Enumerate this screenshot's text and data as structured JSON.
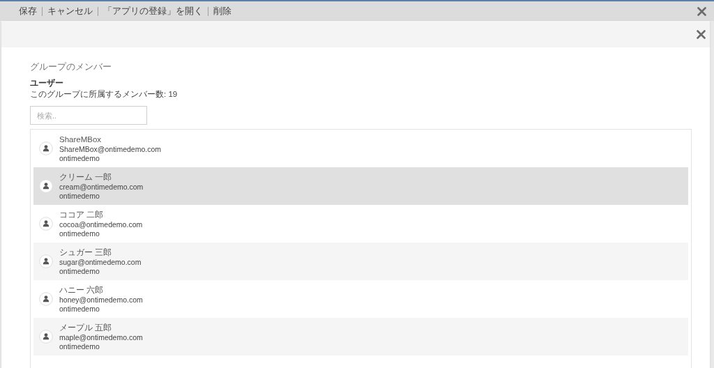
{
  "toolbar": {
    "actions": [
      "保存",
      "キャンセル",
      "「アプリの登録」を開く",
      "削除"
    ]
  },
  "dialog": {
    "section_title": "グループのメンバー",
    "heading": "ユーザー",
    "member_count": "このグループに所属するメンバー数: 19",
    "search": {
      "placeholder": "検索.."
    },
    "members": [
      {
        "name": "ShareMBox",
        "email": "ShareMBox@ontimedemo.com",
        "org": "ontimedemo",
        "hovered": false
      },
      {
        "name": "クリーム 一郎",
        "email": "cream@ontimedemo.com",
        "org": "ontimedemo",
        "hovered": true
      },
      {
        "name": "ココア 二郎",
        "email": "cocoa@ontimedemo.com",
        "org": "ontimedemo",
        "hovered": false
      },
      {
        "name": "シュガー 三郎",
        "email": "sugar@ontimedemo.com",
        "org": "ontimedemo",
        "hovered": false
      },
      {
        "name": "ハニー 六郎",
        "email": "honey@ontimedemo.com",
        "org": "ontimedemo",
        "hovered": false
      },
      {
        "name": "メープル 五郎",
        "email": "maple@ontimedemo.com",
        "org": "ontimedemo",
        "hovered": false
      }
    ]
  }
}
